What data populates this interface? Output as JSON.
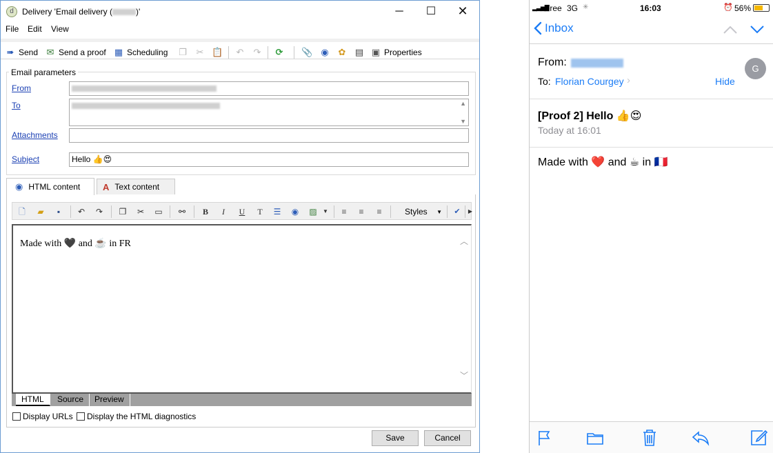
{
  "window": {
    "title_prefix": "Delivery 'Email delivery (",
    "title_suffix": ")'",
    "app_icon": "d"
  },
  "menu": [
    "File",
    "Edit",
    "View"
  ],
  "toolbar": {
    "send": "Send",
    "send_proof": "Send a proof",
    "scheduling": "Scheduling",
    "properties": "Properties"
  },
  "params": {
    "legend": "Email parameters",
    "from_label": "From",
    "to_label": "To",
    "attachments_label": "Attachments",
    "subject_label": "Subject",
    "subject_value": "Hello 👍😍"
  },
  "tabs": {
    "html": "HTML content",
    "text": "Text content"
  },
  "editor": {
    "styles_label": "Styles",
    "body_text": "Made with 🖤 and ☕ in FR",
    "modes": [
      "HTML",
      "Source",
      "Preview"
    ]
  },
  "checkboxes": {
    "display_urls": "Display URLs",
    "html_diag": "Display the HTML diagnostics"
  },
  "buttons": {
    "save": "Save",
    "cancel": "Cancel"
  },
  "phone": {
    "carrier": "Free",
    "network": "3G",
    "time": "16:03",
    "battery": "56%",
    "back": "Inbox",
    "from_label": "From:",
    "to_label": "To:",
    "to_name": "Florian Courgey",
    "hide": "Hide",
    "avatar_letter": "G",
    "subject": "[Proof 2] Hello 👍😍",
    "date": "Today at 16:01",
    "body": "Made with ❤️ and ☕ in 🇫🇷",
    "accent": "#1b7cf6"
  }
}
